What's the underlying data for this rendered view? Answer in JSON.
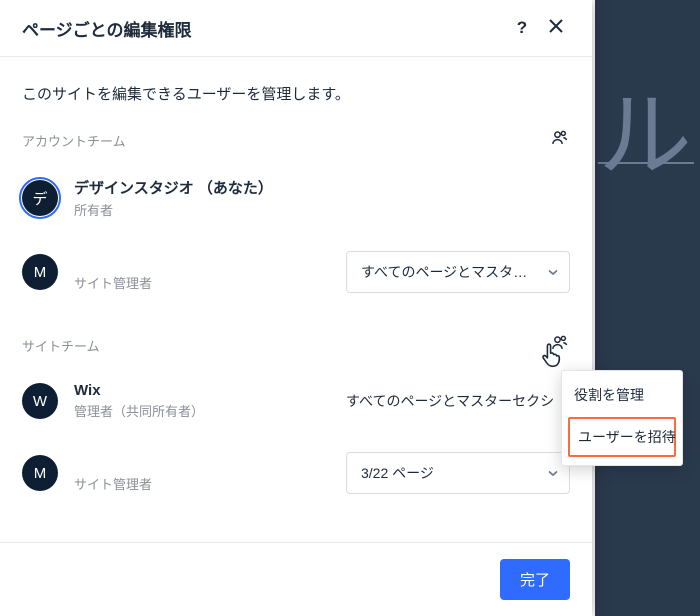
{
  "backdrop": {
    "glyph": "ル"
  },
  "panel": {
    "title": "ページごとの編集権限",
    "intro": "このサイトを編集できるユーザーを管理します。",
    "sections": {
      "account": {
        "label": "アカウントチーム"
      },
      "site": {
        "label": "サイトチーム"
      }
    },
    "members": {
      "account": [
        {
          "avatar": "デ",
          "name": "デザインスタジオ （あなた）",
          "role": "所有者"
        },
        {
          "avatar": "M",
          "name": "",
          "role": "サイト管理者",
          "scope_select": "すべてのページとマスターセ…"
        }
      ],
      "site": [
        {
          "avatar": "W",
          "name": "Wix",
          "role": "管理者（共同所有者）",
          "scope_text": "すべてのページとマスターセクシ"
        },
        {
          "avatar": "M",
          "name": "",
          "role": "サイト管理者",
          "scope_select": "3/22 ページ"
        }
      ]
    },
    "footer": {
      "done": "完了"
    }
  },
  "popover": {
    "items": [
      {
        "label": "役割を管理"
      },
      {
        "label": "ユーザーを招待",
        "highlight": true
      }
    ]
  }
}
